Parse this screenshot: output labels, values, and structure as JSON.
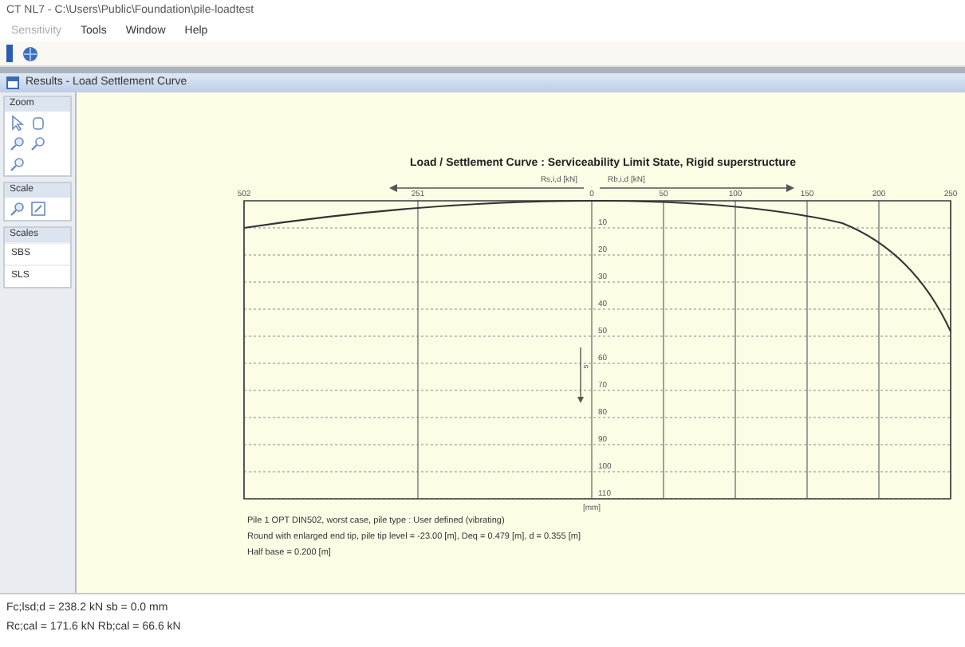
{
  "window": {
    "title": "CT NL7 - C:\\Users\\Public\\Foundation\\pile-loadtest"
  },
  "menu": [
    {
      "label": "Sensitivity",
      "disabled": true
    },
    {
      "label": "Tools",
      "disabled": false
    },
    {
      "label": "Window",
      "disabled": false
    },
    {
      "label": "Help",
      "disabled": false
    }
  ],
  "child_window": {
    "title": "Results - Load Settlement Curve"
  },
  "side_panel": [
    {
      "header": "Zoom",
      "kind": "tools"
    },
    {
      "header": "Scale",
      "kind": "tools"
    },
    {
      "header": "Scales",
      "kind": "list",
      "items": [
        "SBS",
        "SLS"
      ]
    }
  ],
  "chart": {
    "title": "Load / Settlement Curve : Serviceability Limit State, Rigid superstructure",
    "left_axis_label": "Rs,i,d [kN]",
    "right_axis_label": "Rb,i,d [kN]",
    "vertical_axis_label": "s",
    "vertical_axis_unit": "[mm]",
    "left_tick_labels": [
      "502",
      "251"
    ],
    "right_tick_labels": [
      "0",
      "50",
      "100",
      "150",
      "200",
      "250"
    ],
    "vertical_tick_labels": [
      "10",
      "20",
      "30",
      "40",
      "50",
      "60",
      "70",
      "80",
      "90",
      "100",
      "110"
    ],
    "notes": [
      "Pile 1 OPT DIN502, worst case, pile type : User defined (vibrating)",
      "Round with enlarged end tip, pile tip level = -23.00 [m], Deq = 0.479 [m], d = 0.355 [m]",
      "Half base = 0.200 [m]"
    ]
  },
  "status_bar": [
    "Fc;lsd;d = 238.2 kN   sb = 0.0 mm",
    "Rc;cal = 171.6 kN   Rb;cal = 66.6 kN"
  ]
}
